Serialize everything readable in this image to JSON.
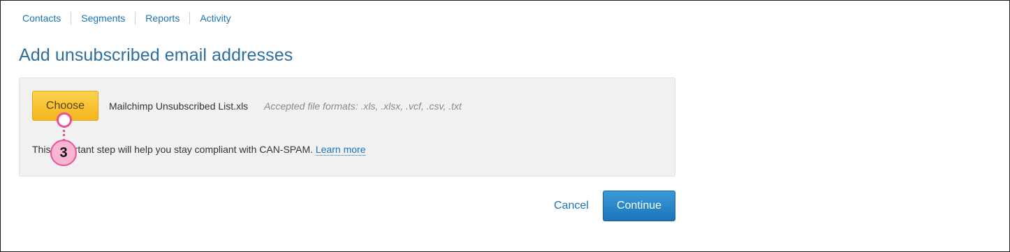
{
  "nav": {
    "items": [
      {
        "label": "Contacts"
      },
      {
        "label": "Segments"
      },
      {
        "label": "Reports"
      },
      {
        "label": "Activity"
      }
    ]
  },
  "page": {
    "title": "Add unsubscribed email addresses"
  },
  "upload": {
    "choose_label": "Choose",
    "filename": "Mailchimp Unsubscribed List.xls",
    "formats": "Accepted file formats: .xls, .xlsx, .vcf, .csv, .txt",
    "notice_prefix": "This important step will help you stay compliant with CAN-SPAM.",
    "learn_more": "Learn more"
  },
  "actions": {
    "cancel": "Cancel",
    "continue": "Continue"
  },
  "callout": {
    "number": "3",
    "color": "#ee4f9a"
  },
  "colors": {
    "accent": "#1a73b8",
    "title": "#2d6e9e",
    "choose_button": "#f4b61f",
    "continue_button": "#1b75bb"
  }
}
